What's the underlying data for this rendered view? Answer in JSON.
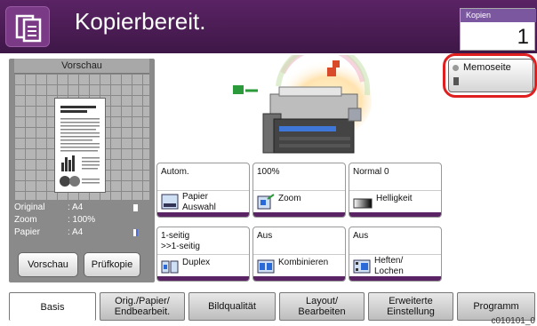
{
  "header": {
    "title": "Kopierbereit.",
    "copies_label": "Kopien",
    "copies_value": "1"
  },
  "preview": {
    "title": "Vorschau",
    "info": [
      {
        "label": "Original",
        "value": ": A4"
      },
      {
        "label": "Zoom",
        "value": ": 100%"
      },
      {
        "label": "Papier",
        "value": ": A4"
      }
    ],
    "preview_button": "Vorschau",
    "check_button": "Prüfkopie"
  },
  "memo_button": "Memoseite",
  "functions": [
    {
      "value": "Autom.",
      "label": "Papier\nAuswahl",
      "icon": "paper-select-icon"
    },
    {
      "value": "100%",
      "label": "Zoom",
      "icon": "zoom-icon"
    },
    {
      "value": "Normal 0",
      "label": "Helligkeit",
      "icon": "density-icon"
    },
    {
      "value": "1-seitig\n>>1-seitig",
      "label": "Duplex",
      "icon": "duplex-icon"
    },
    {
      "value": "Aus",
      "label": "Kombinieren",
      "icon": "combine-icon"
    },
    {
      "value": "Aus",
      "label": "Heften/\nLochen",
      "icon": "staple-icon"
    }
  ],
  "tabs": [
    "Basis",
    "Orig./Papier/\nEndbearbeit.",
    "Bildqualität",
    "Layout/\nBearbeiten",
    "Erweiterte\nEinstellung",
    "Programm"
  ],
  "active_tab": "Basis",
  "image_code": "c010101_0"
}
